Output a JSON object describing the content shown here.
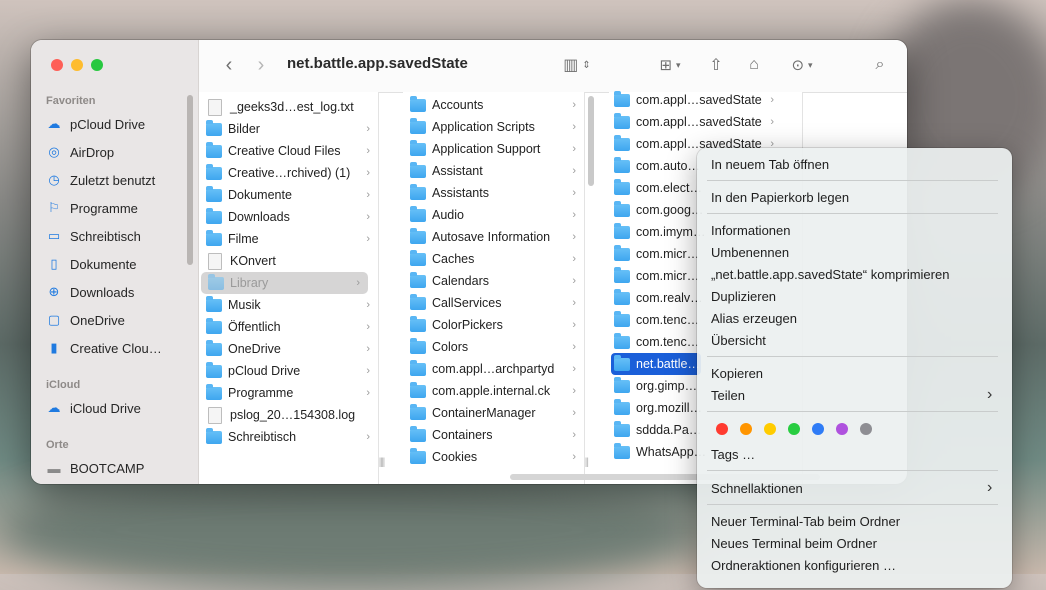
{
  "window": {
    "title": "net.battle.app.savedState"
  },
  "sidebar": {
    "sections": [
      {
        "title": "Favoriten",
        "items": [
          {
            "label": "pCloud Drive",
            "icon": "cloud-drive-icon"
          },
          {
            "label": "AirDrop",
            "icon": "airdrop-icon"
          },
          {
            "label": "Zuletzt benutzt",
            "icon": "clock-icon"
          },
          {
            "label": "Programme",
            "icon": "apps-icon"
          },
          {
            "label": "Schreibtisch",
            "icon": "desktop-icon"
          },
          {
            "label": "Dokumente",
            "icon": "document-icon"
          },
          {
            "label": "Downloads",
            "icon": "download-icon"
          },
          {
            "label": "OneDrive",
            "icon": "folder-icon"
          },
          {
            "label": "Creative Clou…",
            "icon": "file-icon"
          }
        ]
      },
      {
        "title": "iCloud",
        "items": [
          {
            "label": "iCloud Drive",
            "icon": "icloud-icon"
          }
        ]
      },
      {
        "title": "Orte",
        "items": [
          {
            "label": "BOOTCAMP",
            "icon": "disk-icon"
          }
        ]
      }
    ]
  },
  "columns": {
    "col1": [
      {
        "label": "_geeks3d…est_log.txt",
        "type": "doc",
        "chev": false
      },
      {
        "label": "Bilder",
        "type": "folder",
        "chev": true
      },
      {
        "label": "Creative Cloud Files",
        "type": "folder",
        "chev": true
      },
      {
        "label": "Creative…rchived) (1)",
        "type": "folder",
        "chev": true
      },
      {
        "label": "Dokumente",
        "type": "folder",
        "chev": true
      },
      {
        "label": "Downloads",
        "type": "folder",
        "chev": true
      },
      {
        "label": "Filme",
        "type": "folder",
        "chev": true
      },
      {
        "label": "KOnvert",
        "type": "doc",
        "chev": false
      },
      {
        "label": "Library",
        "type": "folder",
        "chev": true,
        "selected": true
      },
      {
        "label": "Musik",
        "type": "folder",
        "chev": true
      },
      {
        "label": "Öffentlich",
        "type": "folder",
        "chev": true
      },
      {
        "label": "OneDrive",
        "type": "folder",
        "chev": true
      },
      {
        "label": "pCloud Drive",
        "type": "folder",
        "chev": true
      },
      {
        "label": "Programme",
        "type": "folder",
        "chev": true
      },
      {
        "label": "pslog_20…154308.log",
        "type": "doc",
        "chev": false
      },
      {
        "label": "Schreibtisch",
        "type": "folder",
        "chev": true
      }
    ],
    "col2": [
      "Accounts",
      "Application Scripts",
      "Application Support",
      "Assistant",
      "Assistants",
      "Audio",
      "Autosave Information",
      "Caches",
      "Calendars",
      "CallServices",
      "ColorPickers",
      "Colors",
      "com.appl…archpartyd",
      "com.apple.internal.ck",
      "ContainerManager",
      "Containers",
      "Cookies"
    ],
    "col3": [
      "com.appl…savedState",
      "com.appl…savedState",
      "com.appl…savedState",
      "com.auto…",
      "com.elect…",
      "com.goog…",
      "com.imym…",
      "com.micr…",
      "com.micr…",
      "com.realv…",
      "com.tenc…",
      "com.tenc…",
      "net.battle…",
      "org.gimp…",
      "org.mozill…",
      "sddda.Pa…",
      "WhatsApp…"
    ]
  },
  "context_menu": {
    "open_new_tab": "In neuem Tab öffnen",
    "trash": "In den Papierkorb legen",
    "info": "Informationen",
    "rename": "Umbenennen",
    "compress": "„net.battle.app.savedState“ komprimieren",
    "duplicate": "Duplizieren",
    "alias": "Alias erzeugen",
    "overview": "Übersicht",
    "copy": "Kopieren",
    "share": "Teilen",
    "tags": "Tags …",
    "quick_actions": "Schnellaktionen",
    "new_terminal_tab": "Neuer Terminal-Tab beim Ordner",
    "new_terminal": "Neues Terminal beim Ordner",
    "folder_actions": "Ordneraktionen konfigurieren …",
    "tag_colors": [
      "#ff3b30",
      "#ff9500",
      "#ffcc00",
      "#28cd41",
      "#2f7cf6",
      "#af52de",
      "#8e8e93"
    ]
  }
}
